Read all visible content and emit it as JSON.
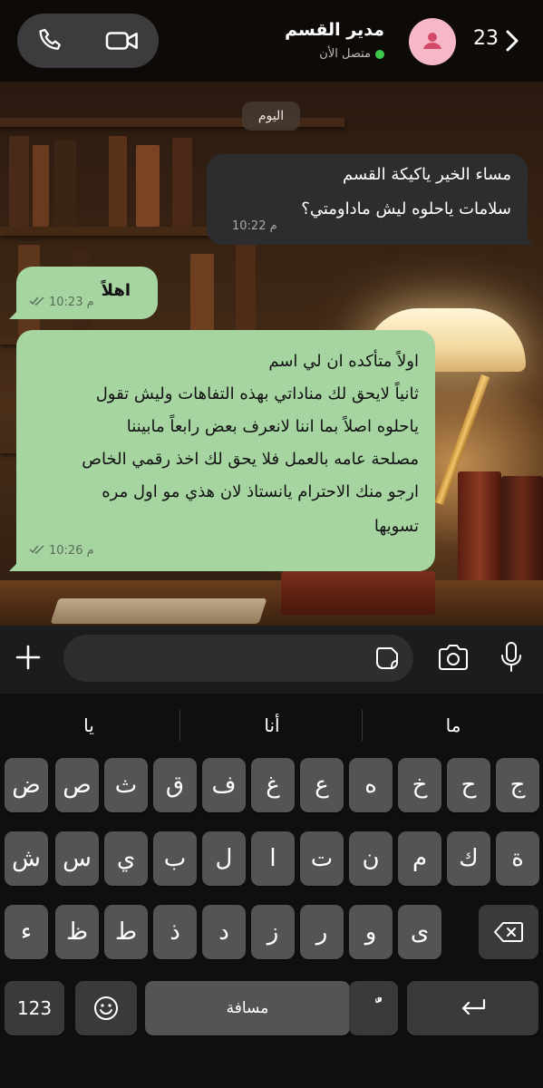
{
  "header": {
    "back_count": "23",
    "contact_name": "مدير القسم",
    "contact_status": "متصل الأن"
  },
  "date_chip": "اليوم",
  "messages": [
    {
      "direction": "incoming",
      "lines": [
        "مساء الخير ياكيكة القسم",
        "سلامات ياحلوه ليش ماداومتي؟"
      ],
      "time": "10:22 م"
    },
    {
      "direction": "outgoing",
      "lines": [
        "اهلاً"
      ],
      "time": "10:23 م",
      "read": true
    },
    {
      "direction": "outgoing",
      "lines": [
        "اولاً متأكده ان لي اسم",
        "ثانياً لايحق لك مناداتي بهذه التفاهات وليش تقول",
        "ياحلوه اصلاً بما اننا لانعرف بعض رابعاً مابيننا",
        "مصلحة عامه بالعمل فلا يحق لك اخذ رقمي الخاص",
        "ارجو منك الاحترام يانستاذ لان هذي مو اول مره",
        "تسويها"
      ],
      "time": "10:26 م",
      "read": true
    }
  ],
  "composer": {
    "placeholder": ""
  },
  "keyboard": {
    "suggestions": [
      "ما",
      "أنا",
      "يا"
    ],
    "row1": [
      "ج",
      "ح",
      "خ",
      "ه",
      "ع",
      "غ",
      "ف",
      "ق",
      "ث",
      "ص",
      "ض"
    ],
    "row2": [
      "ة",
      "ك",
      "م",
      "ن",
      "ت",
      "ا",
      "ل",
      "ب",
      "ي",
      "س",
      "ش"
    ],
    "row3": [
      "ى",
      "و",
      "ر",
      "ز",
      "د",
      "ذ",
      "ط",
      "ظ",
      "ء"
    ],
    "numbers_label": "123",
    "space_label": "مسافة",
    "diacritic_label": "ٌّ"
  },
  "icons": {
    "phone": "phone-icon",
    "video": "video-camera-icon",
    "avatar": "person-icon",
    "back": "chevron-right-icon",
    "plus": "plus-icon",
    "sticker": "sticker-icon",
    "camera": "camera-icon",
    "mic": "microphone-icon",
    "backspace": "backspace-icon",
    "emoji": "emoji-icon",
    "return": "return-icon"
  },
  "colors": {
    "outgoing_bubble": "#a6d5a2",
    "incoming_bubble": "#2d2d2f",
    "online_dot": "#3cc84a",
    "avatar_bg": "#f6b8c6"
  }
}
